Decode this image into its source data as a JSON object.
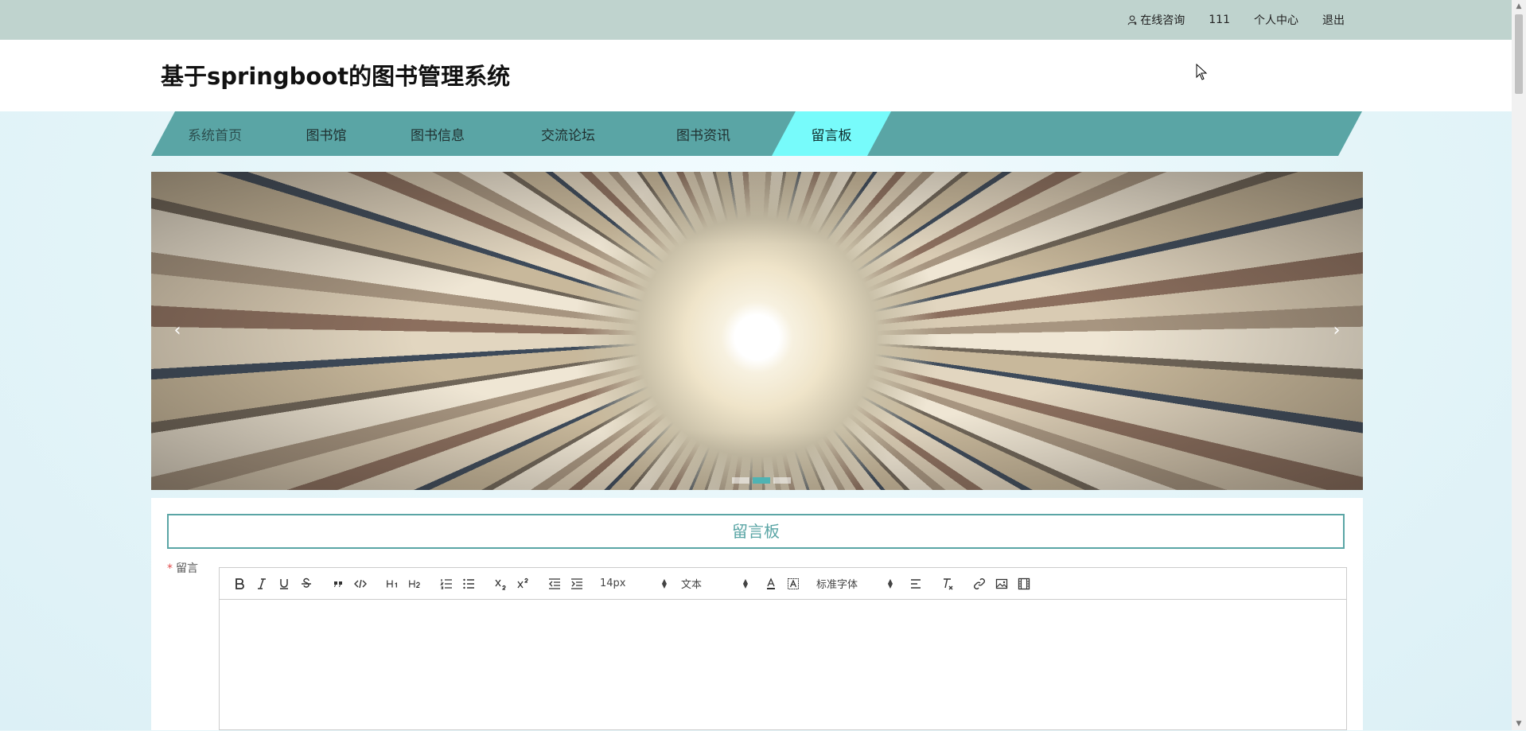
{
  "topbar": {
    "consult_label": "在线咨询",
    "username": "111",
    "profile_label": "个人中心",
    "logout_label": "退出"
  },
  "header": {
    "site_title": "基于springboot的图书管理系统"
  },
  "nav": {
    "items": [
      {
        "label": "系统首页"
      },
      {
        "label": "图书馆"
      },
      {
        "label": "图书信息"
      },
      {
        "label": "交流论坛"
      },
      {
        "label": "图书资讯"
      },
      {
        "label": "留言板",
        "active": true
      }
    ]
  },
  "banner": {
    "prev_label": "‹",
    "next_label": "›",
    "active_slide": 2,
    "slide_count": 3
  },
  "board": {
    "title": "留言板",
    "field_label": "留言",
    "required_mark": "*"
  },
  "editor": {
    "font_size_value": "14px",
    "header_value": "文本",
    "font_family_value": "标准字体"
  },
  "colors": {
    "accent": "#5aa5a5",
    "nav_active": "#77fbfb",
    "topbar": "#bfd3ce"
  }
}
